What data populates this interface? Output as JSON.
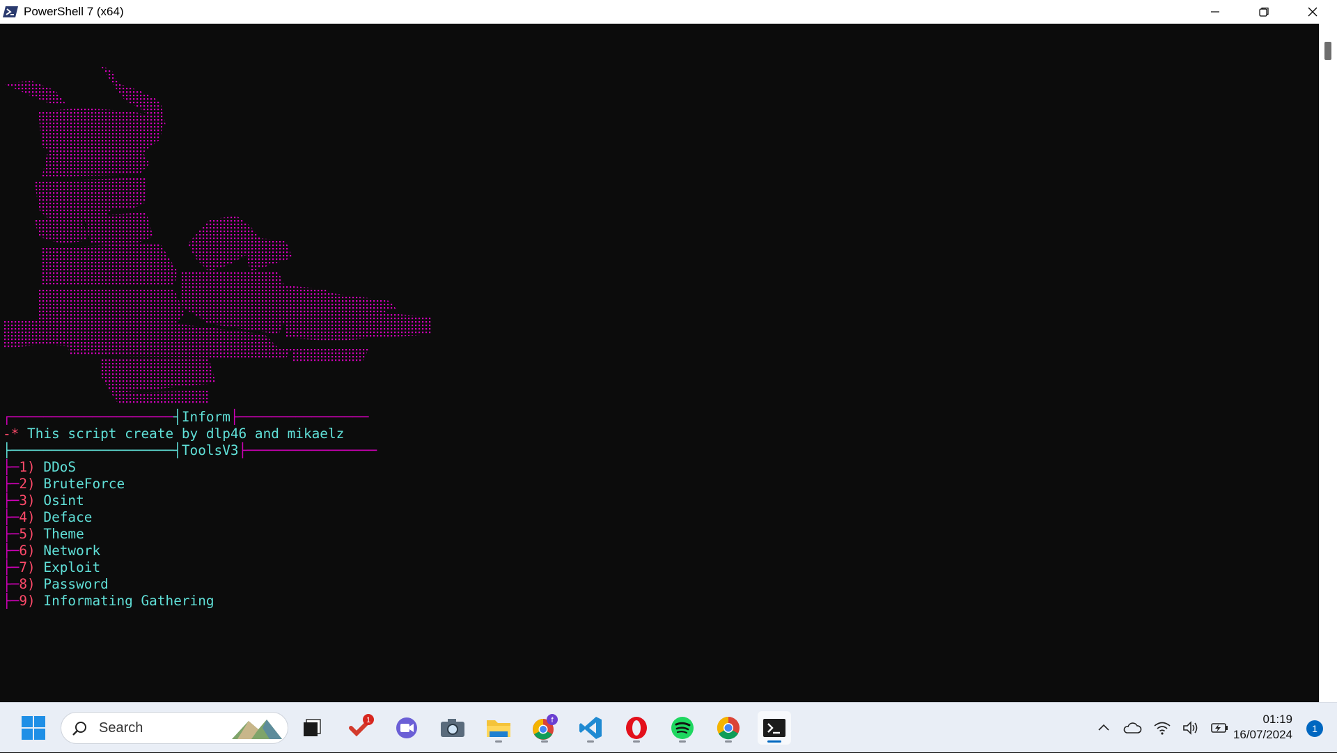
{
  "window": {
    "title": "PowerShell 7 (x64)",
    "icon": "powershell-icon"
  },
  "terminal": {
    "ascii_art_color": "#d000b8",
    "inform_header": "Inform",
    "credit_prefix": "-* ",
    "credit": "This script create by dlp46 and mikaelz",
    "tools_header": "ToolsV3",
    "menu": [
      {
        "num": "1)",
        "label": "DDoS"
      },
      {
        "num": "2)",
        "label": "BruteForce"
      },
      {
        "num": "3)",
        "label": "Osint"
      },
      {
        "num": "4)",
        "label": "Deface"
      },
      {
        "num": "5)",
        "label": "Theme"
      },
      {
        "num": "6)",
        "label": "Network"
      },
      {
        "num": "7)",
        "label": "Exploit"
      },
      {
        "num": "8)",
        "label": "Password"
      },
      {
        "num": "9)",
        "label": "Informating Gathering"
      }
    ]
  },
  "taskbar": {
    "search_placeholder": "Search",
    "apps": [
      "windows-start-icon",
      "task-view-icon",
      "todo-icon",
      "teams-icon",
      "camera-icon",
      "file-explorer-icon",
      "chrome-profile-icon",
      "vscode-icon",
      "opera-icon",
      "spotify-icon",
      "chrome-icon",
      "terminal-icon"
    ],
    "todo_badge": "1",
    "chrome_profile_badge": "f",
    "time": "01:19",
    "date": "16/07/2024",
    "notifications": "1"
  },
  "colors": {
    "terminal_bg": "#0c0c0c",
    "cyan_text": "#60e0d8",
    "magenta": "#d000b8",
    "number_red": "#ff4a6a",
    "accent": "#0067c0"
  }
}
